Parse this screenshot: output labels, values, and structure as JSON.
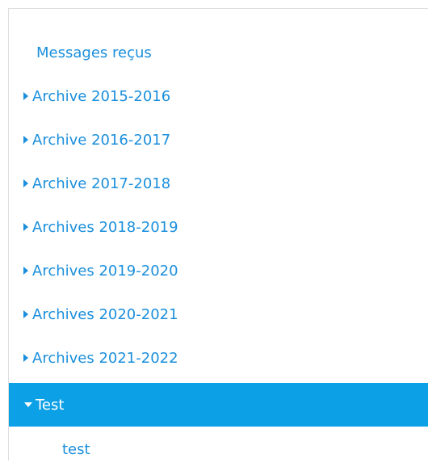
{
  "folders": {
    "root_label": "Messages reçus",
    "items": [
      {
        "label": "Archive 2015-2016"
      },
      {
        "label": "Archive 2016-2017"
      },
      {
        "label": "Archive 2017-2018"
      },
      {
        "label": "Archives 2018-2019"
      },
      {
        "label": "Archives 2019-2020"
      },
      {
        "label": "Archives 2020-2021"
      },
      {
        "label": "Archives 2021-2022"
      }
    ],
    "selected_label": "Test",
    "child_label": "test"
  },
  "colors": {
    "link": "#1b8fdc",
    "selected_bg": "#0ca0e6",
    "selected_text": "#ffffff"
  },
  "icons": {
    "collapsed": "caret-right-icon",
    "expanded": "caret-down-icon"
  }
}
